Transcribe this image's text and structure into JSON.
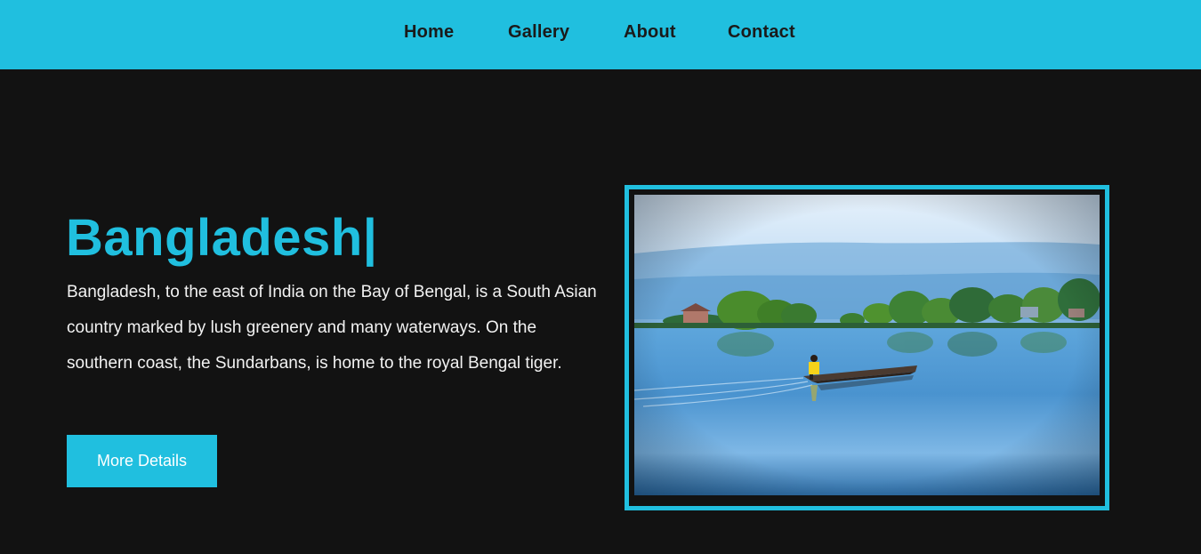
{
  "nav": {
    "items": [
      {
        "label": "Home"
      },
      {
        "label": "Gallery"
      },
      {
        "label": "About"
      },
      {
        "label": "Contact"
      }
    ]
  },
  "hero": {
    "title": "Bangladesh|",
    "description": "Bangladesh, to the east of India on the Bay of Bengal, is a South Asian country marked by lush greenery and many waterways. On the southern coast, the Sundarbans, is home to the royal Bengal tiger.",
    "button_label": "More Details"
  },
  "colors": {
    "accent": "#20bfdf",
    "background": "#121212",
    "nav_text": "#1a1a1a",
    "body_text": "#f2f2f2"
  }
}
